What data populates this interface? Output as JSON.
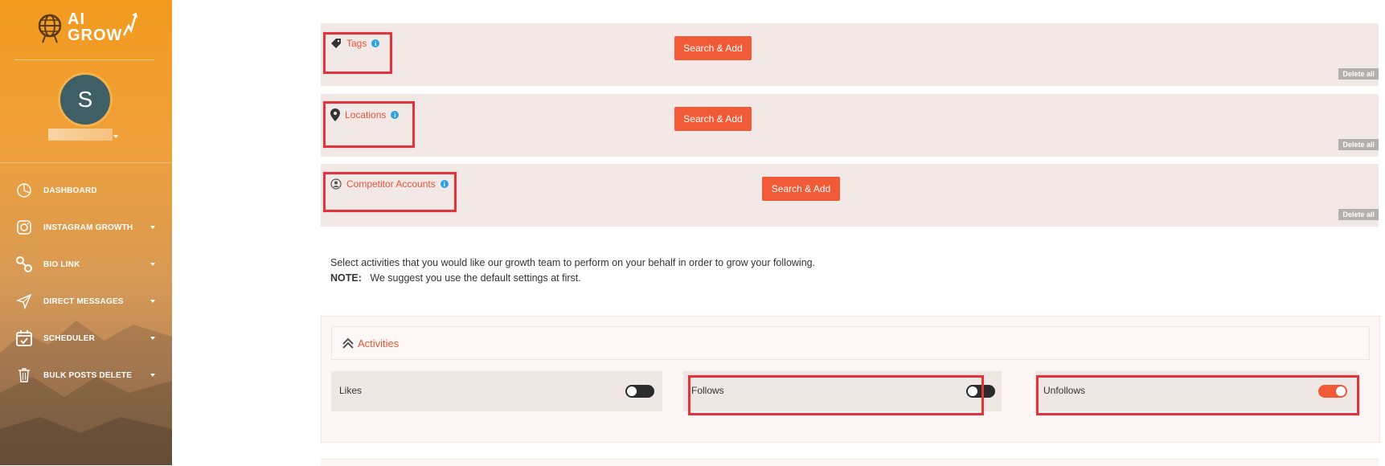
{
  "brand": {
    "logo_text_line1": "AI",
    "logo_text_line2": "GROW",
    "accent": "#f05a37"
  },
  "user": {
    "avatar_initial": "S"
  },
  "sidebar": {
    "items": [
      {
        "label": "DASHBOARD",
        "icon": "pie-chart-icon"
      },
      {
        "label": "INSTAGRAM GROWTH",
        "icon": "instagram-icon"
      },
      {
        "label": "BIO LINK",
        "icon": "link-icon"
      },
      {
        "label": "DIRECT MESSAGES",
        "icon": "send-icon"
      },
      {
        "label": "SCHEDULER",
        "icon": "calendar-icon"
      },
      {
        "label": "BULK POSTS DELETE",
        "icon": "trash-icon"
      }
    ]
  },
  "targets": {
    "tags": {
      "label": "Tags",
      "button": "Search & Add",
      "delete": "Delete all"
    },
    "locations": {
      "label": "Locations",
      "button": "Search & Add",
      "delete": "Delete all"
    },
    "competitors": {
      "label": "Competitor Accounts",
      "button": "Search & Add",
      "delete": "Delete all"
    }
  },
  "description": {
    "line1": "Select activities that you would like our growth team to perform on your behalf in order to grow your following.",
    "note_label": "NOTE:",
    "note_text": "We suggest you use the default settings at first."
  },
  "activities": {
    "title": "Activities",
    "items": [
      {
        "label": "Likes",
        "on": false
      },
      {
        "label": "Follows",
        "on": false
      },
      {
        "label": "Unfollows",
        "on": true
      }
    ]
  }
}
